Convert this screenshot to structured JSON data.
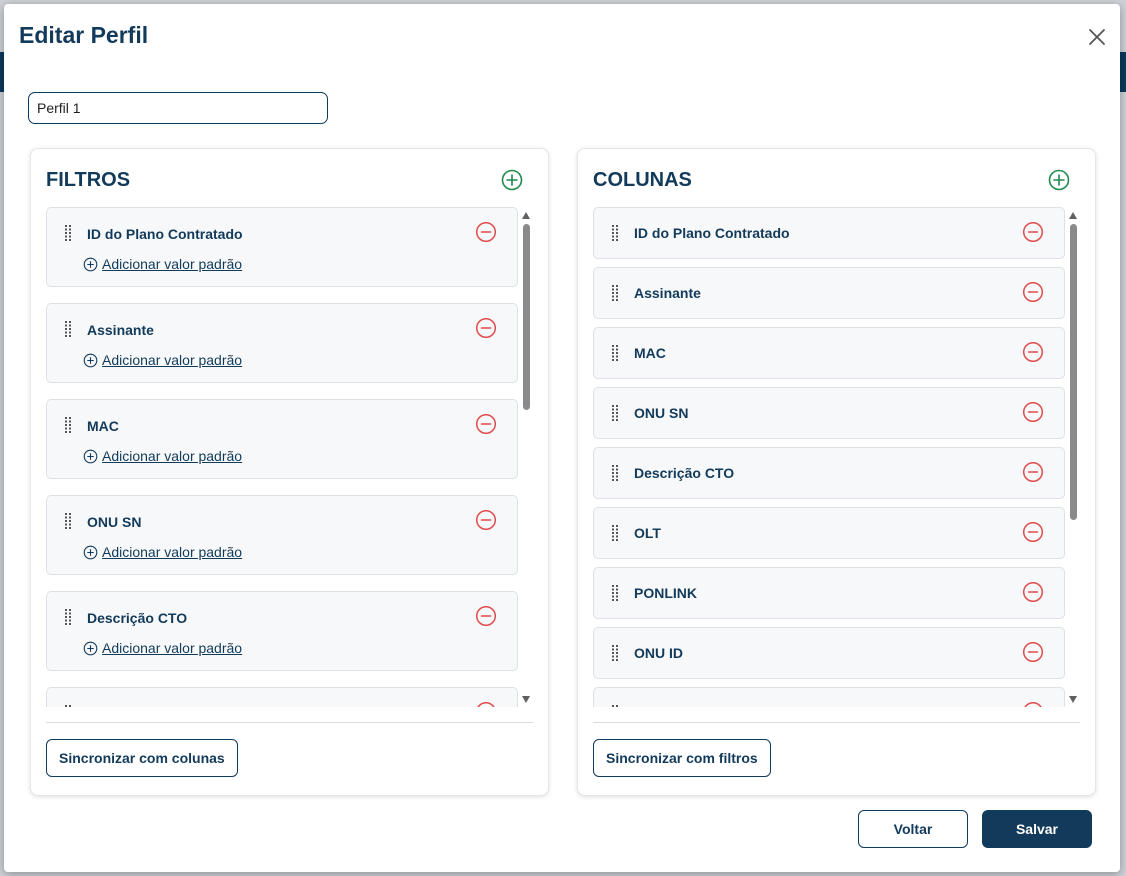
{
  "modal": {
    "title": "Editar Perfil",
    "profile_name_value": "Perfil 1"
  },
  "filters_panel": {
    "title": "FILTROS",
    "add_default_label": "Adicionar valor padrão",
    "items": [
      {
        "label": "ID do Plano Contratado"
      },
      {
        "label": "Assinante"
      },
      {
        "label": "MAC"
      },
      {
        "label": "ONU SN"
      },
      {
        "label": "Descrição CTO"
      }
    ],
    "sync_label": "Sincronizar com colunas"
  },
  "columns_panel": {
    "title": "COLUNAS",
    "items": [
      {
        "label": "ID do Plano Contratado"
      },
      {
        "label": "Assinante"
      },
      {
        "label": "MAC"
      },
      {
        "label": "ONU SN"
      },
      {
        "label": "Descrição CTO"
      },
      {
        "label": "OLT"
      },
      {
        "label": "PONLINK"
      },
      {
        "label": "ONU ID"
      }
    ],
    "sync_label": "Sincronizar com filtros"
  },
  "footer": {
    "back_label": "Voltar",
    "save_label": "Salvar"
  },
  "colors": {
    "primary": "#123a5a",
    "add_icon": "#1e8a4c",
    "remove_icon": "#e04b4b"
  },
  "icons": {
    "close": "close-icon",
    "add": "plus-circle-icon",
    "remove": "minus-circle-icon",
    "drag": "drag-handle-icon",
    "add_default": "plus-circle-small-icon"
  }
}
